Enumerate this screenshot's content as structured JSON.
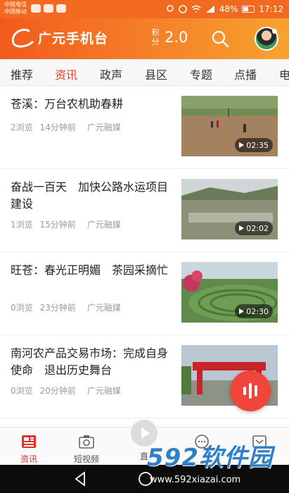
{
  "status_bar": {
    "carrier_1": "中国电信",
    "carrier_2": "中国移动",
    "battery": "48%",
    "time": "17:12"
  },
  "header": {
    "app_name": "广元手机台",
    "points_label": "积分",
    "points_value": "2.0",
    "brand_color": "#f26a1f"
  },
  "tabs": [
    "推荐",
    "资讯",
    "政声",
    "县区",
    "专题",
    "点播",
    "电"
  ],
  "active_tab": 1,
  "news": [
    {
      "title": "苍溪：万台农机助春耕",
      "views": "2浏览",
      "time": "14分钟前",
      "source": "广元融媒",
      "duration": "02:35"
    },
    {
      "title": "奋战一百天　加快公路水运项目建设",
      "views": "1浏览",
      "time": "15分钟前",
      "source": "广元融媒",
      "duration": "02:02"
    },
    {
      "title": "旺苍：春光正明媚　茶园采摘忙",
      "views": "0浏览",
      "time": "23分钟前",
      "source": "广元融媒",
      "duration": "02:30"
    },
    {
      "title": "南河农产品交易市场：完成自身使命　退出历史舞台",
      "views": "0浏览",
      "time": "20分钟前",
      "source": "广元融媒",
      "duration": ""
    }
  ],
  "bottom_nav": [
    {
      "label": "资讯",
      "icon": "news-icon"
    },
    {
      "label": "短视频",
      "icon": "camera-icon"
    },
    {
      "label": "直",
      "icon": "play-icon"
    },
    {
      "label": "",
      "icon": "chat-icon"
    },
    {
      "label": "",
      "icon": "profile-icon"
    }
  ],
  "watermark": {
    "text": "592软件园",
    "url": "www.592xiazai.com"
  }
}
